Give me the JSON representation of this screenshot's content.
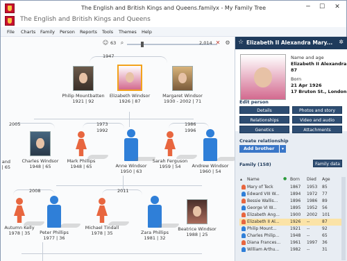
{
  "window": {
    "title": "The English and British Kings and Queens.familyx - My Family Tree",
    "doc_title": "The English and British Kings and Queens",
    "min": "─",
    "max": "☐",
    "close": "✕"
  },
  "menu": [
    "File",
    "Charts",
    "Family",
    "Person",
    "Reports",
    "Tools",
    "Themes",
    "Help"
  ],
  "zoom": {
    "people_count": "63",
    "value": "2,014"
  },
  "tree": {
    "years": [
      "1947",
      "2005",
      "1973",
      "1992",
      "1986",
      "1996",
      "2008",
      "2011"
    ],
    "people": [
      {
        "name": "Philip Mountbatten",
        "dates": "1921 | 92",
        "kind": "photo",
        "style": "photo-bg-1"
      },
      {
        "name": "Elizabeth Windsor",
        "dates": "1926 | 87",
        "kind": "photo",
        "style": "photo-bg-2",
        "selected": true
      },
      {
        "name": "Margaret Windsor",
        "dates": "1930 - 2002 | 71",
        "kind": "photo",
        "style": "photo-bg-3"
      },
      {
        "name": "and",
        "dates": "| 65",
        "kind": "none"
      },
      {
        "name": "Charles Windsor",
        "dates": "1948 | 65",
        "kind": "photo",
        "style": "photo-bg-4"
      },
      {
        "name": "Mark Phillips",
        "dates": "1948 | 65",
        "kind": "male"
      },
      {
        "name": "Anne Windsor",
        "dates": "1950 | 63",
        "kind": "female"
      },
      {
        "name": "Sarah Ferguson",
        "dates": "1959 | 54",
        "kind": "female"
      },
      {
        "name": "Andrew Windsor",
        "dates": "1960 | 54",
        "kind": "male"
      },
      {
        "name": "Autumn Kelly",
        "dates": "1978 | 35",
        "kind": "female"
      },
      {
        "name": "Peter Phillips",
        "dates": "1977 | 36",
        "kind": "male"
      },
      {
        "name": "Michael Tindall",
        "dates": "1978 | 35",
        "kind": "female"
      },
      {
        "name": "Zara Phillips",
        "dates": "1981 | 32",
        "kind": "male"
      },
      {
        "name": "Beatrice Windsor",
        "dates": "1988 | 25",
        "kind": "photo",
        "style": "photo-bg-5"
      }
    ]
  },
  "panel": {
    "header_name": "Elizabeth II Alexandra Mary...",
    "name_label": "Name and age",
    "name_value": "Elizabeth II Alexandra Ma...",
    "age_value": "87",
    "born_label": "Born",
    "born_date": "21 Apr 1926",
    "born_place": "17 Bruton St., London",
    "edit_title": "Edit person",
    "edit_buttons": [
      "Details",
      "Photos and story",
      "Relationships",
      "Video and audio",
      "Genetics",
      "Attachments"
    ],
    "create_title": "Create relationship",
    "add_brother": "Add brother",
    "family_label": "Family (158)",
    "family_data_btn": "Family data",
    "columns": [
      "Name",
      "Born",
      "Died",
      "Age"
    ],
    "rows": [
      {
        "sex": "f",
        "name": "Mary of Teck",
        "born": "1867",
        "died": "1953",
        "age": "85"
      },
      {
        "sex": "m",
        "name": "Edward VIII W...",
        "born": "1894",
        "died": "1972",
        "age": "77"
      },
      {
        "sex": "f",
        "name": "Bessie Wallis...",
        "born": "1896",
        "died": "1986",
        "age": "89"
      },
      {
        "sex": "m",
        "name": "George VI W...",
        "born": "1895",
        "died": "1952",
        "age": "56"
      },
      {
        "sex": "f",
        "name": "Elizabeth Ang...",
        "born": "1900",
        "died": "2002",
        "age": "101"
      },
      {
        "sex": "f",
        "name": "Elizabeth II Al...",
        "born": "1926",
        "died": "--",
        "age": "87",
        "selected": true
      },
      {
        "sex": "m",
        "name": "Philip Mount...",
        "born": "1921",
        "died": "--",
        "age": "92"
      },
      {
        "sex": "m",
        "name": "Charles Philip...",
        "born": "1948",
        "died": "--",
        "age": "65"
      },
      {
        "sex": "f",
        "name": "Diana Frances...",
        "born": "1961",
        "died": "1997",
        "age": "36"
      },
      {
        "sex": "m",
        "name": "William Arthu...",
        "born": "1982",
        "died": "--",
        "age": "31"
      }
    ]
  },
  "colors": {
    "panel_header": "#1f3b5c",
    "edit_button": "#2e4d72",
    "accent_blue": "#3a77c8",
    "selected": "#f2a21b",
    "male": "#2f7fd8",
    "female": "#e8663f"
  }
}
